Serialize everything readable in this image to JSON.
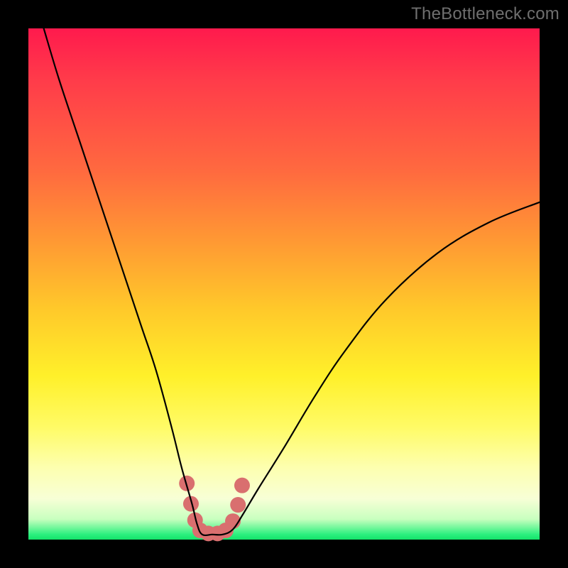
{
  "watermark": "TheBottleneck.com",
  "chart_data": {
    "type": "line",
    "title": "",
    "xlabel": "",
    "ylabel": "",
    "xlim": [
      0,
      100
    ],
    "ylim": [
      0,
      100
    ],
    "series": [
      {
        "name": "bottleneck-curve",
        "x": [
          3,
          6,
          10,
          14,
          18,
          22,
          25,
          28,
          30,
          32,
          33,
          34,
          36,
          38,
          40,
          42,
          45,
          50,
          56,
          62,
          70,
          80,
          90,
          100
        ],
        "y": [
          100,
          90,
          78,
          66,
          54,
          42,
          33,
          22,
          14,
          7,
          3,
          1,
          1,
          1,
          2,
          5,
          10,
          18,
          28,
          37,
          47,
          56,
          62,
          66
        ]
      }
    ],
    "annotations": [
      {
        "name": "valley-marker",
        "type": "dots",
        "color": "#d96f6f",
        "points_x": [
          31.0,
          31.8,
          32.6,
          33.6,
          35.2,
          37.0,
          38.6,
          40.0,
          41.0,
          41.8
        ],
        "points_y": [
          11.0,
          7.0,
          3.8,
          1.8,
          1.2,
          1.2,
          1.8,
          3.6,
          6.8,
          10.6
        ]
      }
    ],
    "gradient_stops": [
      {
        "pos": 0.0,
        "color": "#ff1a4d"
      },
      {
        "pos": 0.28,
        "color": "#ff6a3f"
      },
      {
        "pos": 0.55,
        "color": "#ffc92a"
      },
      {
        "pos": 0.78,
        "color": "#fffb66"
      },
      {
        "pos": 0.96,
        "color": "#c8ffbf"
      },
      {
        "pos": 1.0,
        "color": "#14e36a"
      }
    ]
  }
}
